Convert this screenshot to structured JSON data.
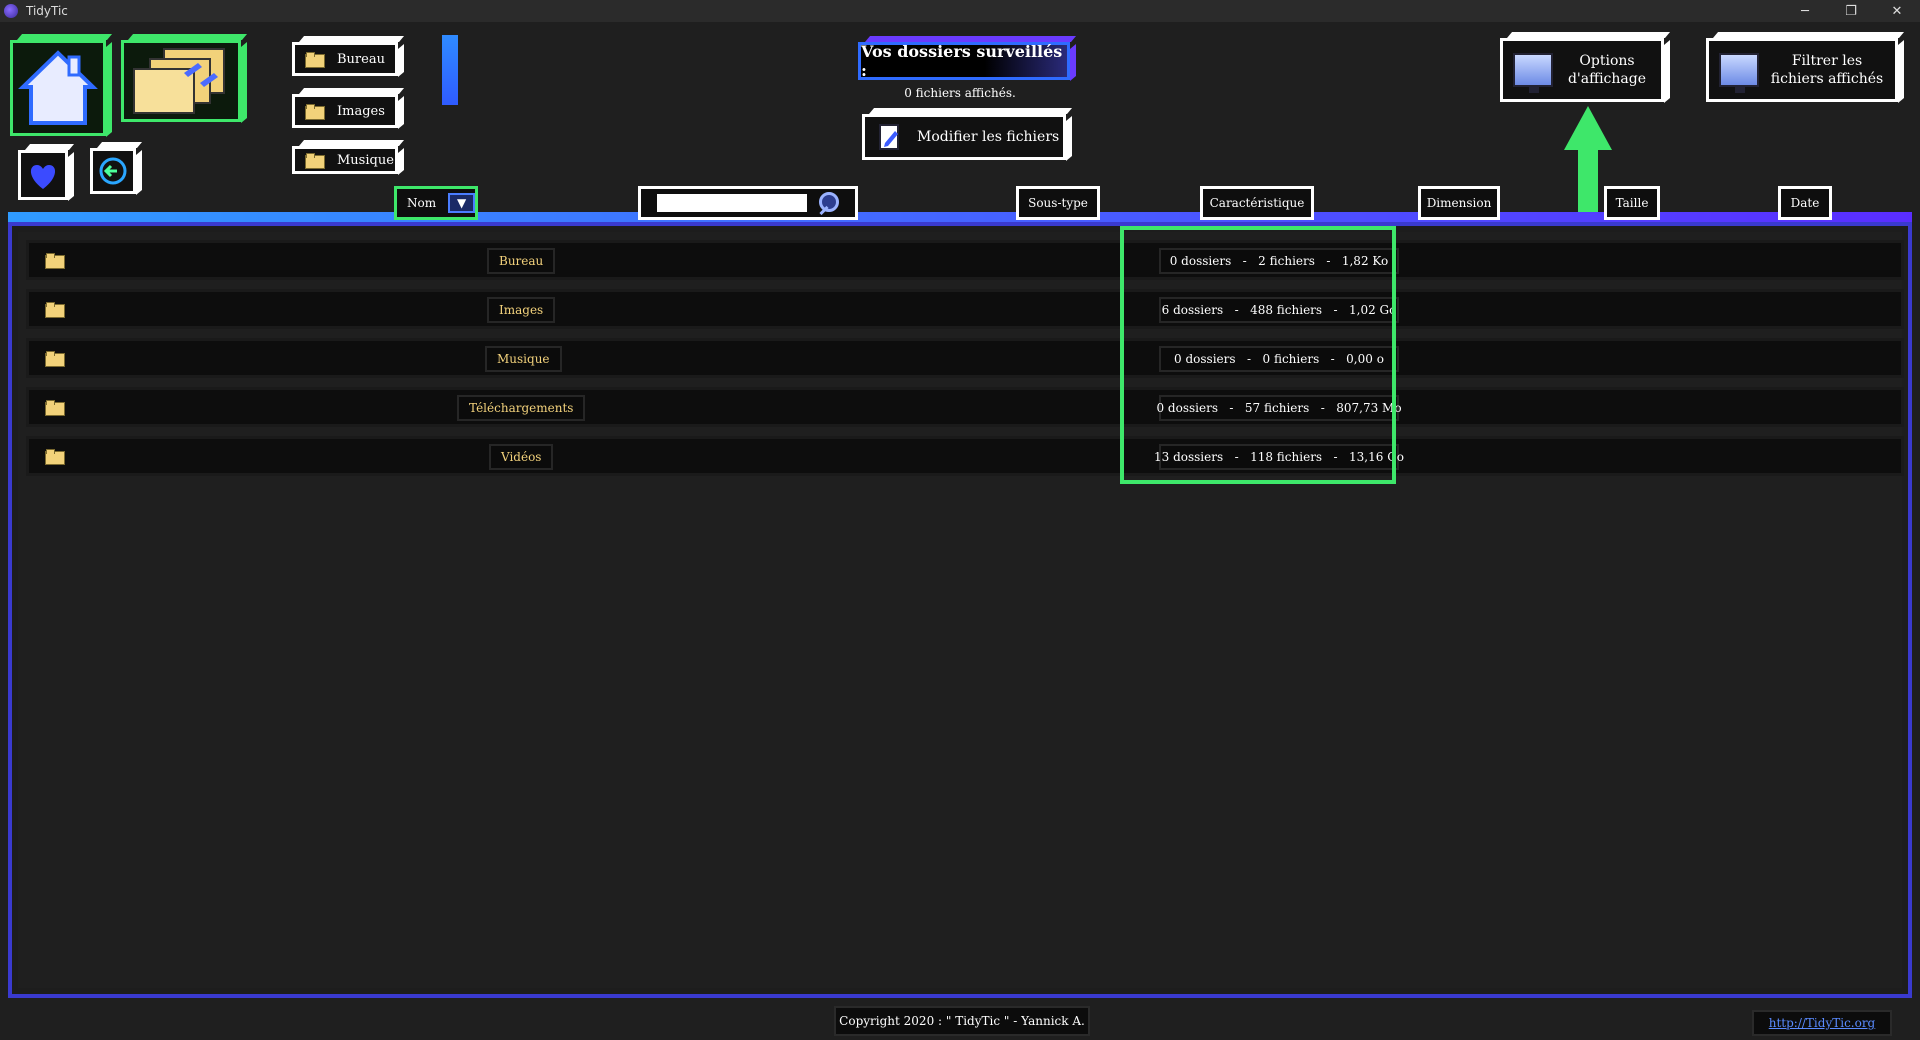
{
  "app": {
    "name": "TidyTic"
  },
  "window": {
    "minimize": "─",
    "restore": "❐",
    "close": "✕"
  },
  "shortcuts": [
    {
      "label": "Bureau"
    },
    {
      "label": "Images"
    },
    {
      "label": "Musique"
    }
  ],
  "header": {
    "title": "Vos dossiers surveillés :",
    "count": "0 fichiers affichés.",
    "modify_label": "Modifier les fichiers",
    "options_line1": "Options",
    "options_line2": "d'affichage",
    "filter_line1": "Filtrer les",
    "filter_line2": "fichiers affichés"
  },
  "columns": {
    "nom": "Nom",
    "sous_type": "Sous-type",
    "caracteristique": "Caractéristique",
    "dimension": "Dimension",
    "taille": "Taille",
    "date": "Date",
    "search_placeholder": ""
  },
  "rows": [
    {
      "name": "Bureau",
      "stats": "0 dossiers   -   2 fichiers   -   1,82 Ko"
    },
    {
      "name": "Images",
      "stats": "6 dossiers   -   488 fichiers   -   1,02 Go"
    },
    {
      "name": "Musique",
      "stats": "0 dossiers   -   0 fichiers   -   0,00 o"
    },
    {
      "name": "Téléchargements",
      "stats": "0 dossiers   -   57 fichiers   -   807,73 Mo"
    },
    {
      "name": "Vidéos",
      "stats": "13 dossiers   -   118 fichiers   -   13,16 Go"
    }
  ],
  "footer": {
    "copyright": "Copyright 2020 : \" TidyTic \" - Yannick A.",
    "link": "http://TidyTic.org"
  },
  "colors": {
    "accent_green": "#3ee76a",
    "accent_blue": "#2f6bff",
    "folder_name": "#f3d27c"
  }
}
